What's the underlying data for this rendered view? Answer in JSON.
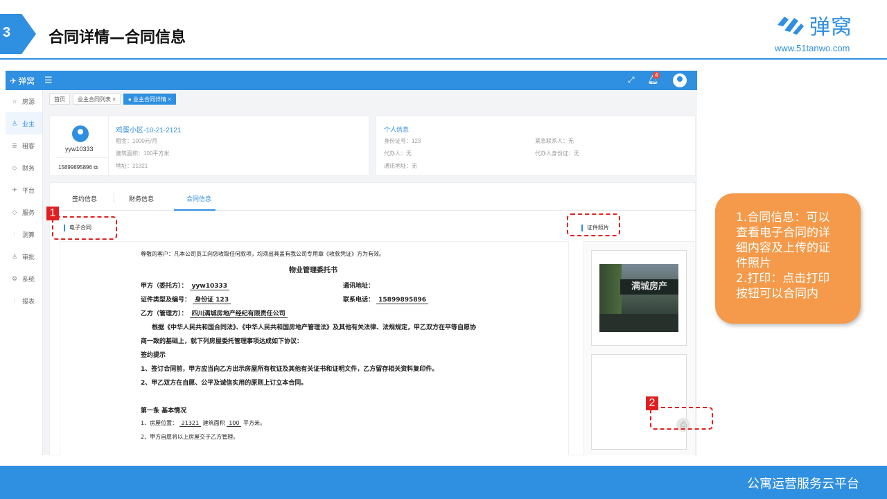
{
  "slide": {
    "number": "3",
    "title": "合同详情—合同信息",
    "brand_name": "弹窝",
    "brand_url": "www.51tanwo.com",
    "footer": "公寓运营服务云平台"
  },
  "app": {
    "logo": "弹窝",
    "notification_count": "4",
    "sidebar": [
      {
        "label": "房源",
        "icon": "home-icon"
      },
      {
        "label": "业主",
        "icon": "user-icon",
        "active": true
      },
      {
        "label": "租客",
        "icon": "database-icon"
      },
      {
        "label": "财务",
        "icon": "diamond-icon"
      },
      {
        "label": "平台",
        "icon": "plane-icon"
      },
      {
        "label": "服务",
        "icon": "tag-icon"
      },
      {
        "label": "测算",
        "icon": "sliders-icon"
      },
      {
        "label": "审批",
        "icon": "person-icon"
      },
      {
        "label": "系统",
        "icon": "gear-icon"
      },
      {
        "label": "报表",
        "icon": "sliders-icon"
      }
    ],
    "breadcrumbs": [
      "首页",
      "业主合同列表 ×",
      "● 业主合同详情 ×"
    ],
    "owner": {
      "username": "yyw10333",
      "phone": "15899895896",
      "property_title": "鸡蛋小区-10-21-2121",
      "rent": "租金：1000元/月",
      "area": "建筑面积：100平方米",
      "address": "地址：21321"
    },
    "personal": {
      "title": "个人信息",
      "id_no": "身份证号：123",
      "agent": "代办人：无",
      "mail_address": "通讯地址：无",
      "emergency": "紧急联系人：无",
      "agent_id": "代办人身份证：无"
    },
    "tabs": [
      "签约信息",
      "财务信息",
      "合同信息"
    ],
    "sections": {
      "contract": "电子合同",
      "photos": "证件照片"
    },
    "document": {
      "notice": "尊敬的客户：凡本公司员工向您收取任何款项，均须出具盖有我公司专用章《收款凭证》方为有效。",
      "title": "物业管理委托书",
      "party_a_label": "甲方（委托方）：",
      "party_a": "yyw10333",
      "mail_label": "通讯地址：",
      "cert_label": "证件类型及编号：",
      "cert": "身份证 123",
      "phone_label": "联系电话：",
      "phone": "15899895896",
      "party_b_label": "乙方（管理方）：",
      "party_b": "四川满城房地产经纪有限责任公司",
      "law1": "根据《中华人民共和国合同法》、《中华人民共和国房地产管理法》及其他有关法律、法规规定，甲乙双方在平等自愿协",
      "law2": "商一致的基础上，就下列房屋委托管理事项达成如下协议：",
      "tips_title": "签约提示",
      "tip1": "1、签订合同前，甲方应当向乙方出示房屋所有权证及其他有关证书和证明文件，乙方留存相关资料复印件。",
      "tip2": "2、甲乙双方在自愿、公平及诚信实用的原则上订立本合同。",
      "article1": "第一条 基本情况",
      "item1_pre": "1、房屋位置：",
      "item1_loc": "21321",
      "item1_mid": "建筑面积",
      "item1_area": "100",
      "item1_post": "平方米。",
      "item2": "2、甲方自愿将以上房屋交于乙方管理。"
    },
    "photo_sign": "满城房产"
  },
  "annotations": {
    "marker1": "1",
    "marker2": "2",
    "callout_lines": [
      "1.合同信息：可以",
      "查看电子合同的详",
      "细内容及上传的证",
      "件照片",
      "2.打印：点击打印",
      "按钮可以合同内"
    ]
  }
}
